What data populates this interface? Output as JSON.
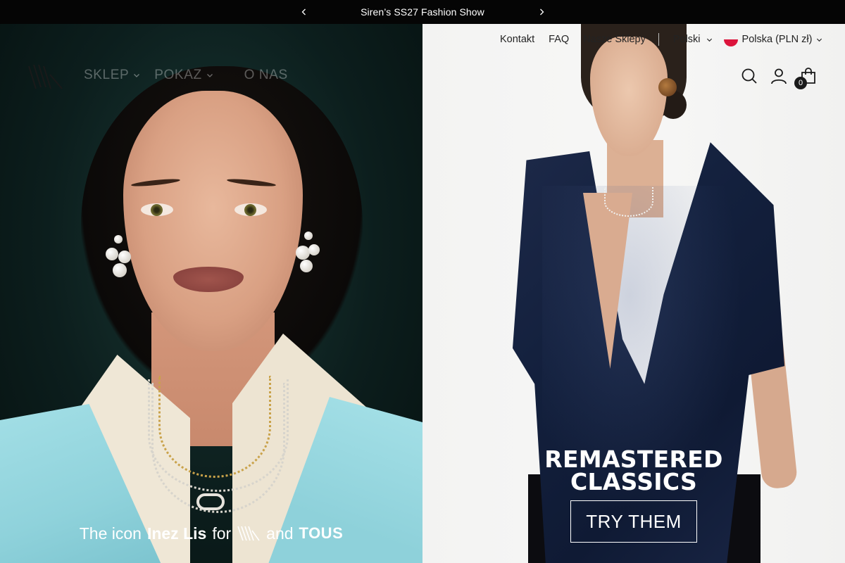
{
  "announcement": {
    "text": "Siren’s SS27 Fashion Show",
    "prev_icon": "chevron-left-icon",
    "next_icon": "chevron-right-icon"
  },
  "header": {
    "logo_icon": "brand-logo",
    "main_nav": [
      {
        "label": "SKLEP",
        "has_dropdown": true
      },
      {
        "label": "POKAZ",
        "has_dropdown": true
      },
      {
        "label": "O NAS",
        "has_dropdown": false
      }
    ],
    "top_links": {
      "kontakt": "Kontakt",
      "faq": "FAQ",
      "stores": "Nasze Sklepy"
    },
    "language": "Polski",
    "country": "Polska (PLN zł)",
    "country_flag": "poland-flag-icon",
    "cart_count": "0"
  },
  "left_hero": {
    "caption_prefix": "The icon",
    "caption_name": "Inez Lis",
    "caption_for": "for",
    "caption_and": "and",
    "caption_partner": "TOUS"
  },
  "right_hero": {
    "headline_line1": "REMASTERED",
    "headline_line2": "CLASSICS",
    "cta": "TRY THEM"
  },
  "colors": {
    "announcement_bg": "#050505",
    "top_link_text": "#232323",
    "nav_text_faded": "rgba(255,255,255,0.32)",
    "coat": "#9ad8e0",
    "blouse": "#152140"
  }
}
